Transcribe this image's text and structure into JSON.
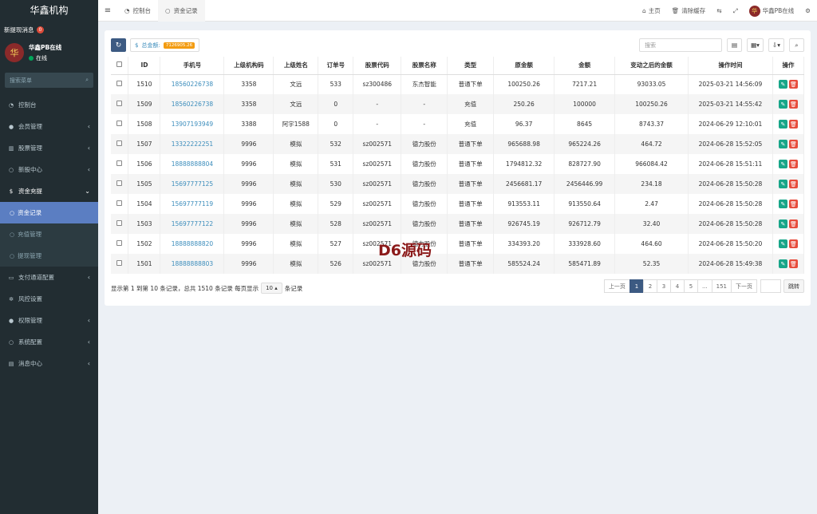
{
  "sidebar": {
    "brand": "华鑫机构",
    "notice_label": "新提现消息",
    "notice_count": "0",
    "user_name": "华鑫PB在线",
    "user_status": "在线",
    "search_placeholder": "搜索菜单",
    "menu": [
      {
        "label": "控制台"
      },
      {
        "label": "会员管理"
      },
      {
        "label": "股票管理"
      },
      {
        "label": "新股中心"
      },
      {
        "label": "资金充提"
      }
    ],
    "submenu": [
      {
        "label": "资金记录"
      },
      {
        "label": "充值管理"
      },
      {
        "label": "提现管理"
      }
    ],
    "menu2": [
      {
        "label": "支付通道配置"
      },
      {
        "label": "风控设置"
      },
      {
        "label": "权限管理"
      },
      {
        "label": "系统配置"
      },
      {
        "label": "消息中心"
      }
    ]
  },
  "topbar": {
    "tabs": [
      {
        "label": "控制台"
      },
      {
        "label": "资金记录"
      }
    ],
    "home": "主页",
    "clear_cache": "清除缓存",
    "user": "华鑫PB在线"
  },
  "toolbar": {
    "total_label": "总金额:",
    "total_value": "7126905.26",
    "search_placeholder": "搜索"
  },
  "table": {
    "headers": [
      "ID",
      "手机号",
      "上级机构码",
      "上级姓名",
      "订单号",
      "股票代码",
      "股票名称",
      "类型",
      "原金额",
      "金额",
      "变动之后的金额",
      "操作时间",
      "操作"
    ],
    "rows": [
      [
        "1510",
        "18560226738",
        "3358",
        "文远",
        "533",
        "sz300486",
        "东杰智能",
        "普通下单",
        "100250.26",
        "7217.21",
        "93033.05",
        "2025-03-21 14:56:09"
      ],
      [
        "1509",
        "18560226738",
        "3358",
        "文远",
        "0",
        "-",
        "-",
        "充值",
        "250.26",
        "100000",
        "100250.26",
        "2025-03-21 14:55:42"
      ],
      [
        "1508",
        "13907193949",
        "3388",
        "阿宇1588",
        "0",
        "-",
        "-",
        "充值",
        "96.37",
        "8645",
        "8743.37",
        "2024-06-29 12:10:01"
      ],
      [
        "1507",
        "13322222251",
        "9996",
        "模拟",
        "532",
        "sz002571",
        "德力股份",
        "普通下单",
        "965688.98",
        "965224.26",
        "464.72",
        "2024-06-28 15:52:05"
      ],
      [
        "1506",
        "18888888804",
        "9996",
        "模拟",
        "531",
        "sz002571",
        "德力股份",
        "普通下单",
        "1794812.32",
        "828727.90",
        "966084.42",
        "2024-06-28 15:51:11"
      ],
      [
        "1505",
        "15697777125",
        "9996",
        "模拟",
        "530",
        "sz002571",
        "德力股份",
        "普通下单",
        "2456681.17",
        "2456446.99",
        "234.18",
        "2024-06-28 15:50:28"
      ],
      [
        "1504",
        "15697777119",
        "9996",
        "模拟",
        "529",
        "sz002571",
        "德力股份",
        "普通下单",
        "913553.11",
        "913550.64",
        "2.47",
        "2024-06-28 15:50:28"
      ],
      [
        "1503",
        "15697777122",
        "9996",
        "模拟",
        "528",
        "sz002571",
        "德力股份",
        "普通下单",
        "926745.19",
        "926712.79",
        "32.40",
        "2024-06-28 15:50:28"
      ],
      [
        "1502",
        "18888888820",
        "9996",
        "模拟",
        "527",
        "sz002571",
        "德力股份",
        "普通下单",
        "334393.20",
        "333928.60",
        "464.60",
        "2024-06-28 15:50:20"
      ],
      [
        "1501",
        "18888888803",
        "9996",
        "模拟",
        "526",
        "sz002571",
        "德力股份",
        "普通下单",
        "585524.24",
        "585471.89",
        "52.35",
        "2024-06-28 15:49:38"
      ]
    ]
  },
  "footer": {
    "info_prefix": "显示第 1 到第 10 条记录，总共 1510 条记录 每页显示",
    "page_size": "10",
    "info_suffix": "条记录",
    "pages": [
      "上一页",
      "1",
      "2",
      "3",
      "4",
      "5",
      "...",
      "151",
      "下一页"
    ],
    "jump": "跳转"
  },
  "watermark": "D6源码"
}
